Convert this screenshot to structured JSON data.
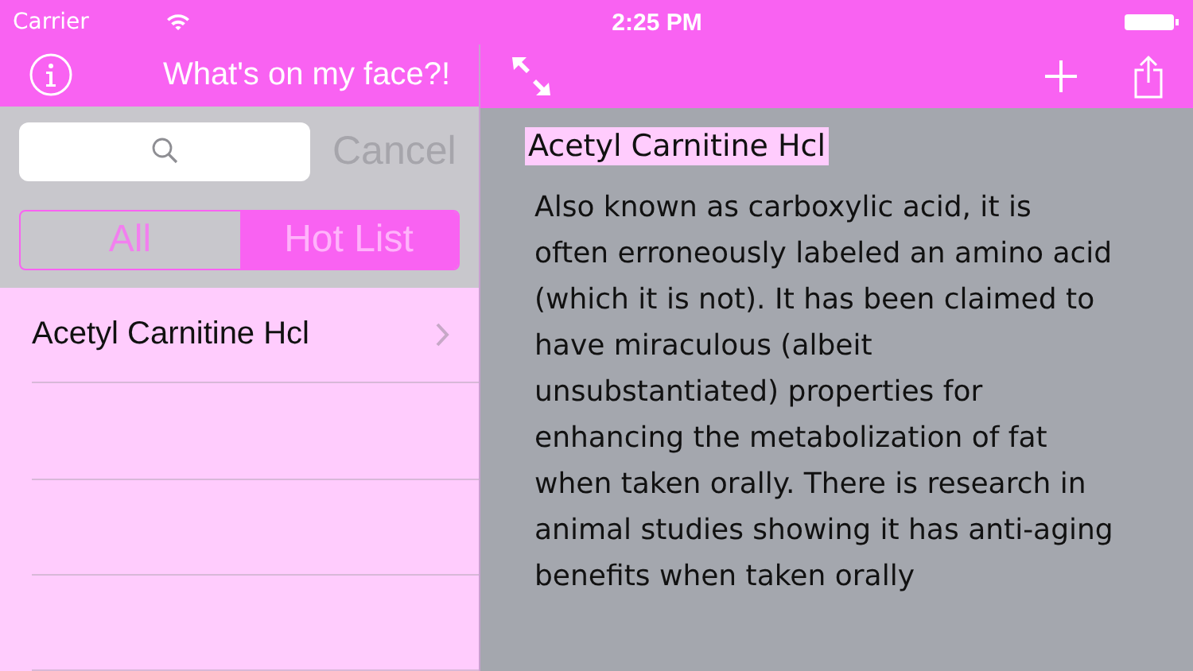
{
  "status_bar": {
    "carrier": "Carrier",
    "time": "2:25 PM"
  },
  "master": {
    "title": "What's on my face?!",
    "cancel": "Cancel",
    "segments": [
      {
        "label": "All",
        "selected": false
      },
      {
        "label": "Hot List",
        "selected": true
      }
    ],
    "rows": [
      {
        "label": "Acetyl Carnitine Hcl"
      }
    ]
  },
  "detail": {
    "heading": "Acetyl Carnitine Hcl",
    "body": "Also known as carboxylic acid, it is often erroneously labeled an amino acid (which it is not). It has been claimed to have miraculous (albeit unsubstantiated) properties for enhancing the metabolization of fat when taken orally. There is research in animal studies showing it has anti-aging benefits when taken orally"
  }
}
